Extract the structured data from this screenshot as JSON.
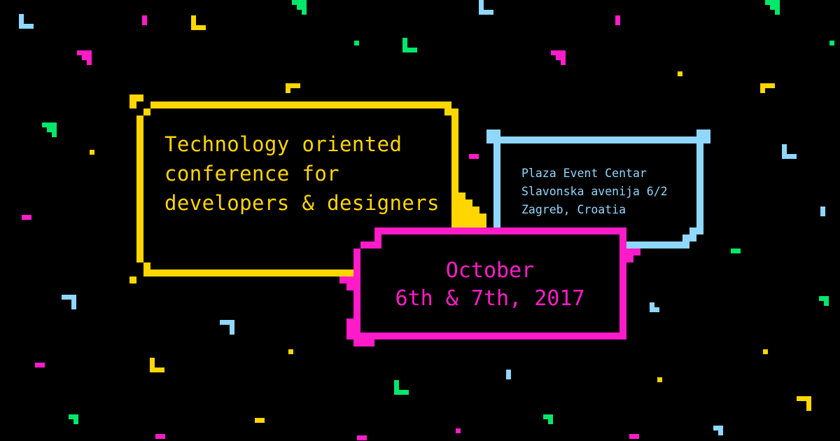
{
  "tagline": "Technology oriented conference for developers & designers",
  "venue": {
    "lines": [
      "Plaza Event Centar",
      "Slavonska avenija 6/2",
      "Zagreb, Croatia"
    ]
  },
  "date": {
    "line1": "October",
    "line2": "6th & 7th, 2017"
  },
  "colors": {
    "background": "#000000",
    "yellow": "#ffd600",
    "blue": "#8fd7ff",
    "magenta": "#ff1bc8",
    "green": "#00e86a"
  }
}
